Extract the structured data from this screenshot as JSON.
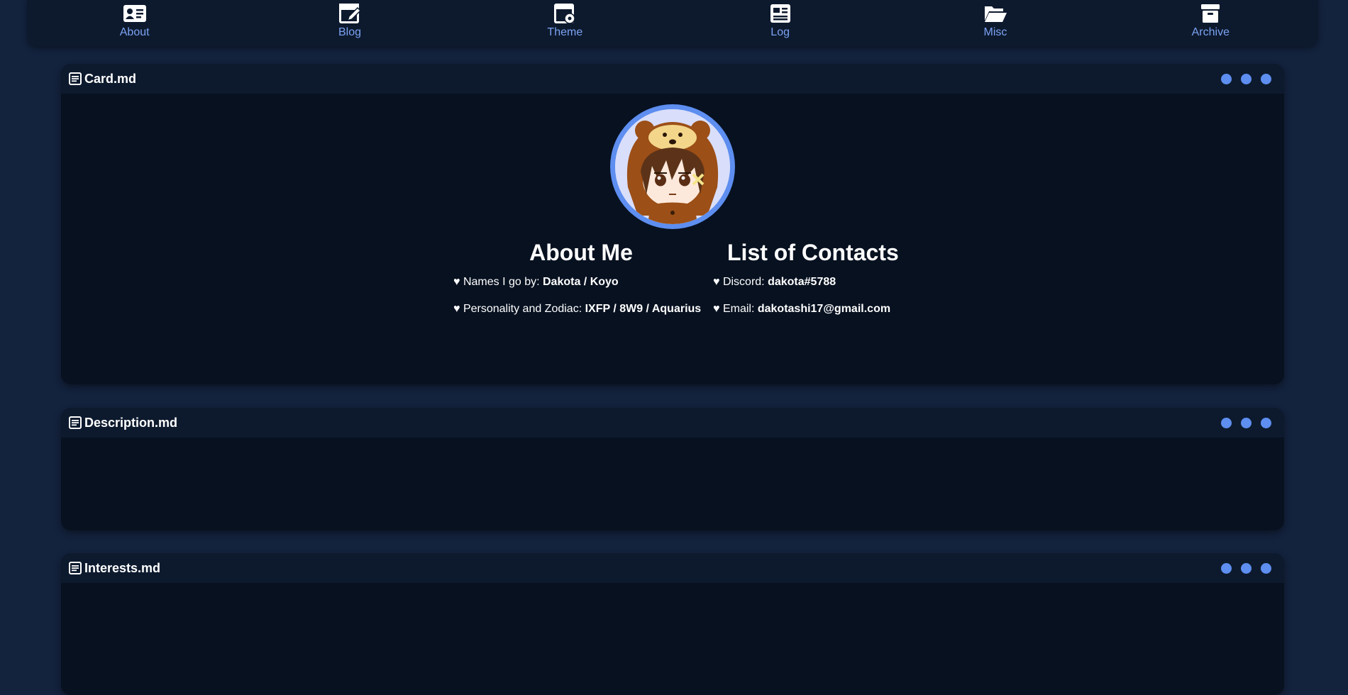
{
  "nav": {
    "items": [
      {
        "label": "About",
        "icon": "id-card-icon"
      },
      {
        "label": "Blog",
        "icon": "pen-square-icon"
      },
      {
        "label": "Theme",
        "icon": "window-gear-icon"
      },
      {
        "label": "Log",
        "icon": "newspaper-icon"
      },
      {
        "label": "Misc",
        "icon": "folder-open-icon"
      },
      {
        "label": "Archive",
        "icon": "archive-box-icon"
      }
    ]
  },
  "windows": {
    "card": {
      "title": "Card.md",
      "about": {
        "heading": "About Me",
        "names_label": "♥ Names I go by: ",
        "names_value": "Dakota / Koyo",
        "personality_label": "♥ Personality and Zodiac: ",
        "personality_value": "IXFP / 8W9 / Aquarius"
      },
      "contacts": {
        "heading": "List of Contacts",
        "discord_label": "♥ Discord: ",
        "discord_value": "dakota#5788",
        "email_label": "♥ Email: ",
        "email_value": "dakotashi17@gmail.com"
      }
    },
    "description": {
      "title": "Description.md"
    },
    "interests": {
      "title": "Interests.md"
    }
  },
  "colors": {
    "background": "#13223d",
    "panel": "#0d1a2e",
    "window_body": "#071120",
    "accent": "#5d8ef0",
    "nav_label": "#7ba2f2"
  }
}
